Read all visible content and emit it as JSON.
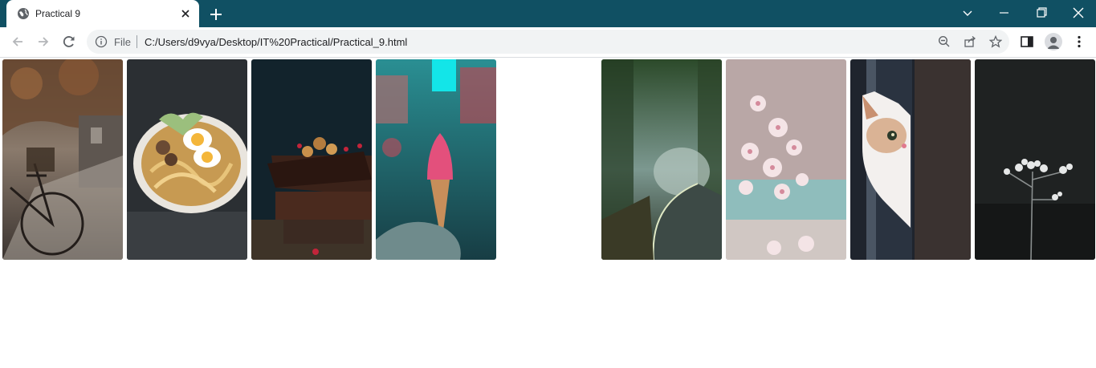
{
  "browser": {
    "tab": {
      "title": "Practical 9",
      "favicon": "globe-icon",
      "close": "close-icon"
    },
    "new_tab": "plus-icon",
    "window_controls": [
      "chevron-down-icon",
      "minimize-icon",
      "restore-icon",
      "close-icon"
    ],
    "nav": [
      "back-arrow-icon",
      "forward-arrow-icon",
      "reload-icon"
    ],
    "address": {
      "info_icon": "info-icon",
      "scheme": "File",
      "url": "C:/Users/d9vya/Desktop/IT%20Practical/Practical_9.html",
      "right_icons": [
        "zoom-out-icon",
        "share-icon",
        "star-icon"
      ]
    },
    "toolbar_icons": [
      "side-panel-icon",
      "profile-avatar-icon",
      "kebab-menu-icon"
    ],
    "colors": {
      "tabstrip": "#105063",
      "toolbar": "#ffffff",
      "omnibox": "#f1f3f4"
    }
  },
  "gallery": {
    "images": [
      {
        "subject": "bicycle on autumn street"
      },
      {
        "subject": "ramen bowl with eggs"
      },
      {
        "subject": "chocolate brownie stack with nuts"
      },
      {
        "subject": "pink ice cream cone in hand"
      },
      {
        "subject": "misty forest road"
      },
      {
        "subject": "cherry blossom flowers"
      },
      {
        "subject": "white kitten peeking from door"
      },
      {
        "subject": "white wildflower in dark"
      }
    ]
  }
}
